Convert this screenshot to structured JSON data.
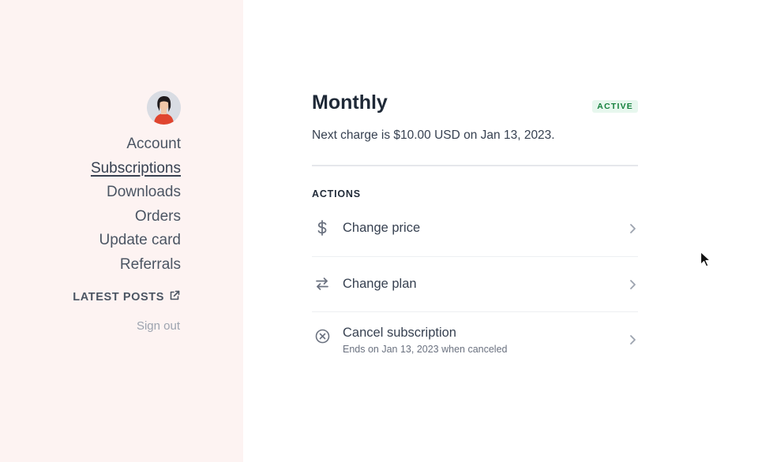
{
  "sidebar": {
    "avatar_icon": "user-avatar-icon",
    "nav": [
      {
        "label": "Account",
        "current": false
      },
      {
        "label": "Subscriptions",
        "current": true
      },
      {
        "label": "Downloads",
        "current": false
      },
      {
        "label": "Orders",
        "current": false
      },
      {
        "label": "Update card",
        "current": false
      },
      {
        "label": "Referrals",
        "current": false
      }
    ],
    "latest_posts": "LATEST POSTS",
    "latest_posts_icon": "external-link-icon",
    "sign_out": "Sign out"
  },
  "subscription": {
    "plan_name": "Monthly",
    "status_badge": "ACTIVE",
    "next_charge": "Next charge is $10.00 USD on Jan 13, 2023.",
    "actions_heading": "ACTIONS",
    "actions": [
      {
        "label": "Change price",
        "icon": "dollar-icon"
      },
      {
        "label": "Change plan",
        "icon": "swap-arrows-icon"
      },
      {
        "label": "Cancel subscription",
        "icon": "cancel-circle-icon",
        "sub": "Ends on Jan 13, 2023 when canceled"
      }
    ]
  },
  "colors": {
    "sidebar_bg": "#fdf3f2",
    "badge_bg": "#e7f7ee",
    "badge_text": "#15803d",
    "avatar_shirt": "#e0452f"
  }
}
